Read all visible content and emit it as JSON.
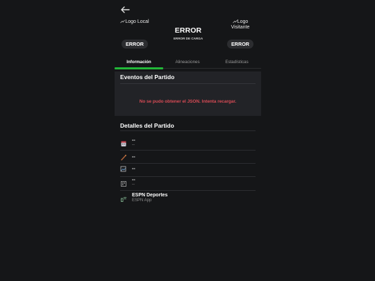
{
  "header": {
    "back_icon": "arrow-left-icon",
    "local": {
      "logo_alt": "Logo Local",
      "score_pill": "ERROR"
    },
    "visitor": {
      "logo_alt": "Logo Visitante",
      "score_pill": "ERROR"
    },
    "score_text": "ERROR",
    "status_text": "ERROR DE CARGA"
  },
  "tabs": [
    {
      "label": "Información",
      "active": true
    },
    {
      "label": "Alineaciones",
      "active": false
    },
    {
      "label": "Estadísticas",
      "active": false
    }
  ],
  "events": {
    "title": "Eventos del Partido",
    "error_message": "No se pudo obtener el JSON. Intenta recargar."
  },
  "details": {
    "title": "Detalles del Partido",
    "rows": [
      {
        "icon": "calendar-icon",
        "main": "--",
        "sub": "--"
      },
      {
        "icon": "whistle-icon",
        "main": "--",
        "sub": ""
      },
      {
        "icon": "broken-image-icon",
        "main": "--",
        "sub": ""
      },
      {
        "icon": "stadium-icon",
        "main": "--",
        "sub": "--"
      },
      {
        "icon": "broadcast-icon",
        "main": "ESPN Deportes",
        "sub": "ESPN App"
      }
    ]
  },
  "colors": {
    "background": "#151618",
    "card": "#222327",
    "accent_green": "#22b838",
    "error_red": "#d84b55",
    "pill": "#2c2d30"
  }
}
